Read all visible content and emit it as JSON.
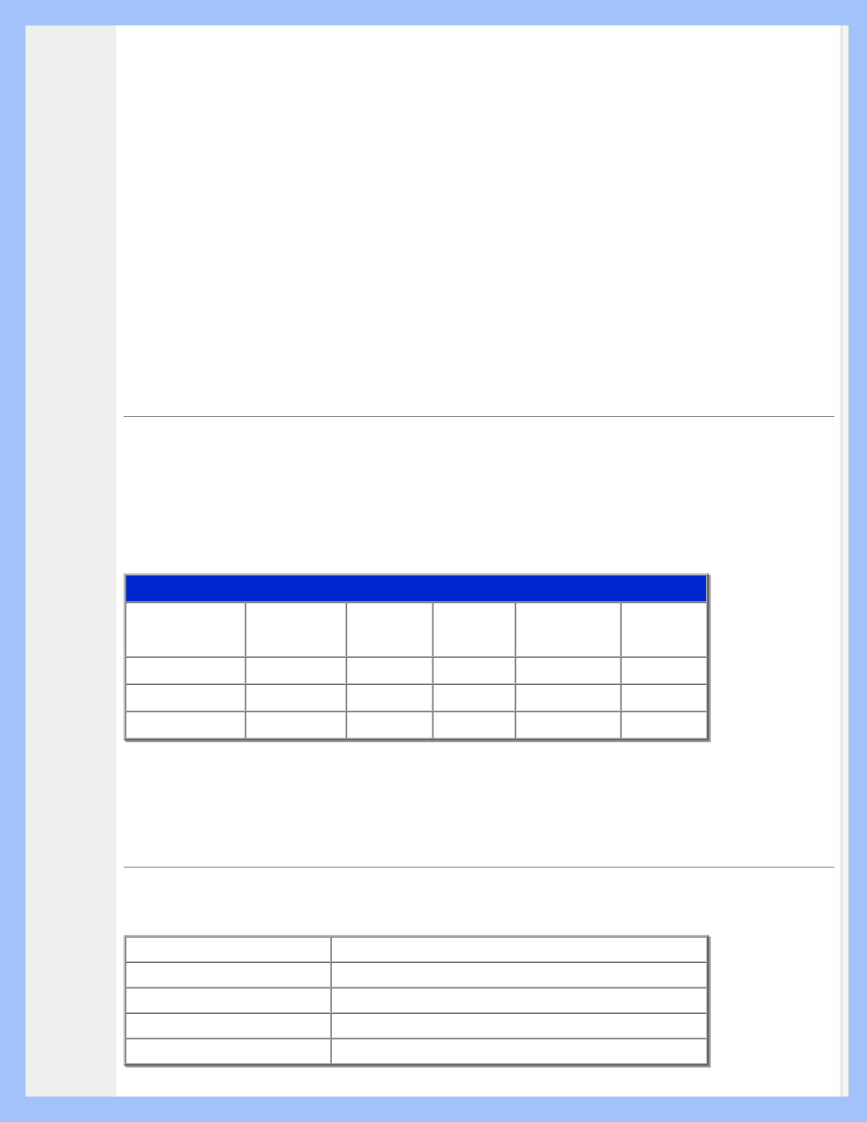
{
  "colors": {
    "page_bg": "#a3c2fa",
    "sidebar_bg": "#efefef",
    "header_row_bg": "#0026cf"
  },
  "table1": {
    "header": "",
    "columns": [
      "",
      "",
      "",
      "",
      "",
      ""
    ],
    "rows": [
      [
        "",
        "",
        "",
        "",
        "",
        ""
      ],
      [
        "",
        "",
        "",
        "",
        "",
        ""
      ],
      [
        "",
        "",
        "",
        "",
        "",
        ""
      ]
    ]
  },
  "table2": {
    "rows": [
      [
        "",
        ""
      ],
      [
        "",
        ""
      ],
      [
        "",
        ""
      ],
      [
        "",
        ""
      ],
      [
        "",
        ""
      ]
    ]
  }
}
